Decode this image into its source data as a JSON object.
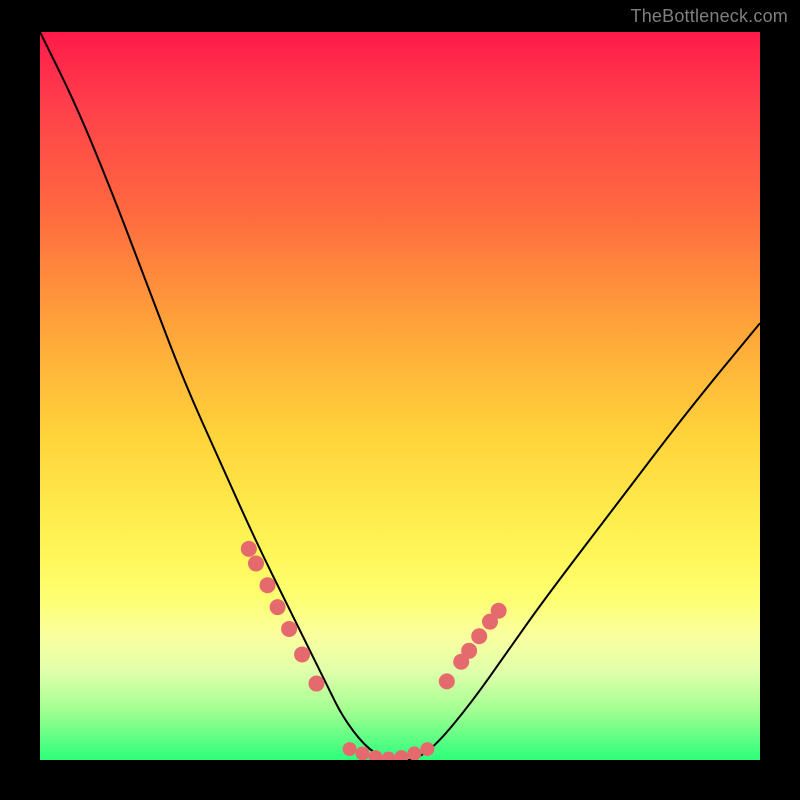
{
  "watermark": "TheBottleneck.com",
  "chart_data": {
    "type": "line",
    "title": "",
    "xlabel": "",
    "ylabel": "",
    "xlim": [
      0,
      100
    ],
    "ylim": [
      0,
      100
    ],
    "series": [
      {
        "name": "bottleneck-curve",
        "x": [
          0,
          5,
          10,
          15,
          20,
          25,
          30,
          35,
          40,
          42,
          45,
          48,
          50,
          52,
          55,
          60,
          65,
          70,
          80,
          90,
          100
        ],
        "y": [
          100,
          90,
          78,
          65,
          52,
          41,
          30,
          20,
          10,
          6,
          2,
          0,
          0,
          0,
          2,
          8,
          15,
          22,
          35,
          48,
          60
        ]
      }
    ],
    "left_markers": {
      "x": [
        29,
        30,
        31.6,
        33,
        34.6,
        36.4,
        38.4
      ],
      "y": [
        29,
        27,
        24,
        21,
        18,
        14.5,
        10.5
      ]
    },
    "right_markers": {
      "x": [
        56.5,
        58.5,
        59.6,
        61,
        62.5,
        63.7
      ],
      "y": [
        10.8,
        13.5,
        15,
        17,
        19,
        20.5
      ]
    },
    "flat_markers": {
      "x": [
        43,
        44.8,
        46.6,
        48.4,
        50.2,
        52,
        53.8
      ],
      "y": [
        1.5,
        0.9,
        0.4,
        0.2,
        0.4,
        0.9,
        1.5
      ]
    },
    "colors": {
      "curve": "#000000",
      "markers": "#e46a6e",
      "gradient_top": "#ff1a4a",
      "gradient_bottom": "#2cff7a"
    }
  }
}
